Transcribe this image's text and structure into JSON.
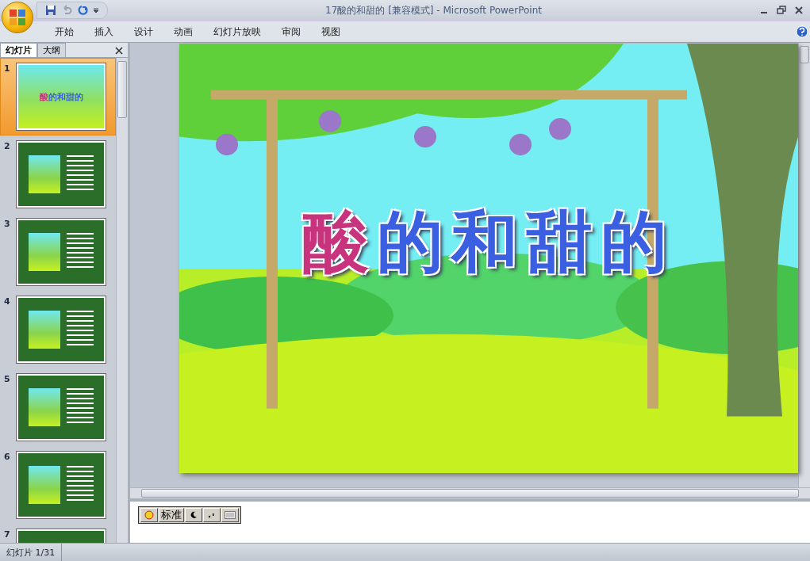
{
  "window": {
    "title": "17酸的和甜的 [兼容模式] - Microsoft PowerPoint"
  },
  "ribbon_tabs": [
    {
      "label": "开始"
    },
    {
      "label": "插入"
    },
    {
      "label": "设计"
    },
    {
      "label": "动画"
    },
    {
      "label": "幻灯片放映"
    },
    {
      "label": "审阅"
    },
    {
      "label": "视图"
    }
  ],
  "pane_tabs": [
    {
      "label": "幻灯片",
      "selected": true
    },
    {
      "label": "大纲",
      "selected": false
    }
  ],
  "thumbnails": [
    {
      "number": "1",
      "kind": "title",
      "selected": true,
      "title": [
        {
          "text": "酸",
          "color": "#c8337e"
        },
        {
          "text": "的和甜的",
          "color": "#3a5fe0"
        }
      ]
    },
    {
      "number": "2",
      "kind": "story",
      "selected": false
    },
    {
      "number": "3",
      "kind": "story",
      "selected": false
    },
    {
      "number": "4",
      "kind": "story",
      "selected": false
    },
    {
      "number": "5",
      "kind": "story",
      "selected": false
    },
    {
      "number": "6",
      "kind": "story",
      "selected": false
    },
    {
      "number": "7",
      "kind": "story",
      "selected": false
    }
  ],
  "slide": {
    "title": [
      {
        "text": "酸",
        "color": "#c8337e"
      },
      {
        "text": "的和甜的",
        "color": "#3a5fe0"
      }
    ]
  },
  "ime_toolbar": {
    "mode": "标准"
  },
  "status_bar": {
    "slide_counter": "幻灯片 1/31"
  }
}
